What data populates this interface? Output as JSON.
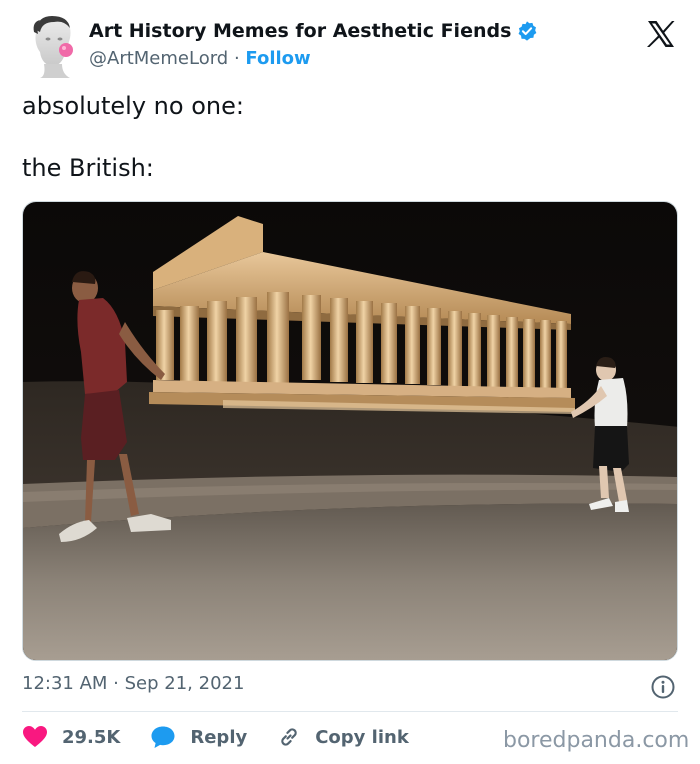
{
  "author": {
    "name": "Art History Memes for Aesthetic Fiends",
    "handle": "@ArtMemeLord",
    "separator": " · ",
    "follow_label": "Follow"
  },
  "tweet": {
    "line1": "absolutely no one:",
    "line2": "the British:"
  },
  "meta": {
    "time": "12:31 AM",
    "separator": " · ",
    "date": "Sep 21, 2021"
  },
  "actions": {
    "like_count": "29.5K",
    "reply_label": "Reply",
    "copy_link_label": "Copy link"
  },
  "watermark": "boredpanda.com",
  "colors": {
    "text": "#0f1419",
    "secondary": "#536471",
    "accent": "#1d9bf0",
    "like": "#f91880"
  },
  "icons": [
    "avatar",
    "verified-badge-icon",
    "x-logo-icon",
    "info-icon",
    "heart-icon",
    "reply-bubble-icon",
    "link-icon"
  ]
}
